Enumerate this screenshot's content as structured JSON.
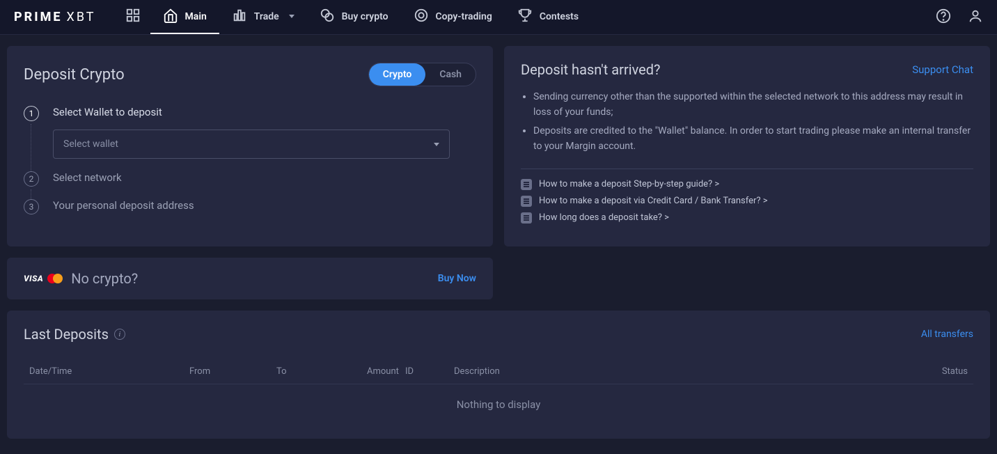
{
  "brand": {
    "prime": "PRIME",
    "xbt": "XBT"
  },
  "nav": {
    "main": "Main",
    "trade": "Trade",
    "buy_crypto": "Buy crypto",
    "copy_trading": "Copy-trading",
    "contests": "Contests"
  },
  "deposit": {
    "title": "Deposit Crypto",
    "toggle_crypto": "Crypto",
    "toggle_cash": "Cash",
    "step1_label": "Select Wallet to deposit",
    "select_placeholder": "Select wallet",
    "step2_label": "Select network",
    "step3_label": "Your personal deposit address"
  },
  "no_crypto": {
    "visa": "VISA",
    "text": "No crypto?",
    "buy_now": "Buy Now"
  },
  "info": {
    "title": "Deposit hasn't arrived?",
    "support": "Support Chat",
    "bullet1": "Sending currency other than the supported within the selected network to this address may result in loss of your funds;",
    "bullet2": "Deposits are credited to the \"Wallet\" balance. In order to start trading please make an internal transfer to your Margin account.",
    "faq1": "How to make a deposit Step-by-step guide? >",
    "faq2": "How to make a deposit via Credit Card / Bank Transfer? >",
    "faq3": "How long does a deposit take? >"
  },
  "last_deposits": {
    "title": "Last Deposits",
    "all_transfers": "All transfers",
    "columns": {
      "datetime": "Date/Time",
      "from": "From",
      "to": "To",
      "amount": "Amount",
      "id": "ID",
      "description": "Description",
      "status": "Status"
    },
    "empty": "Nothing to display"
  }
}
